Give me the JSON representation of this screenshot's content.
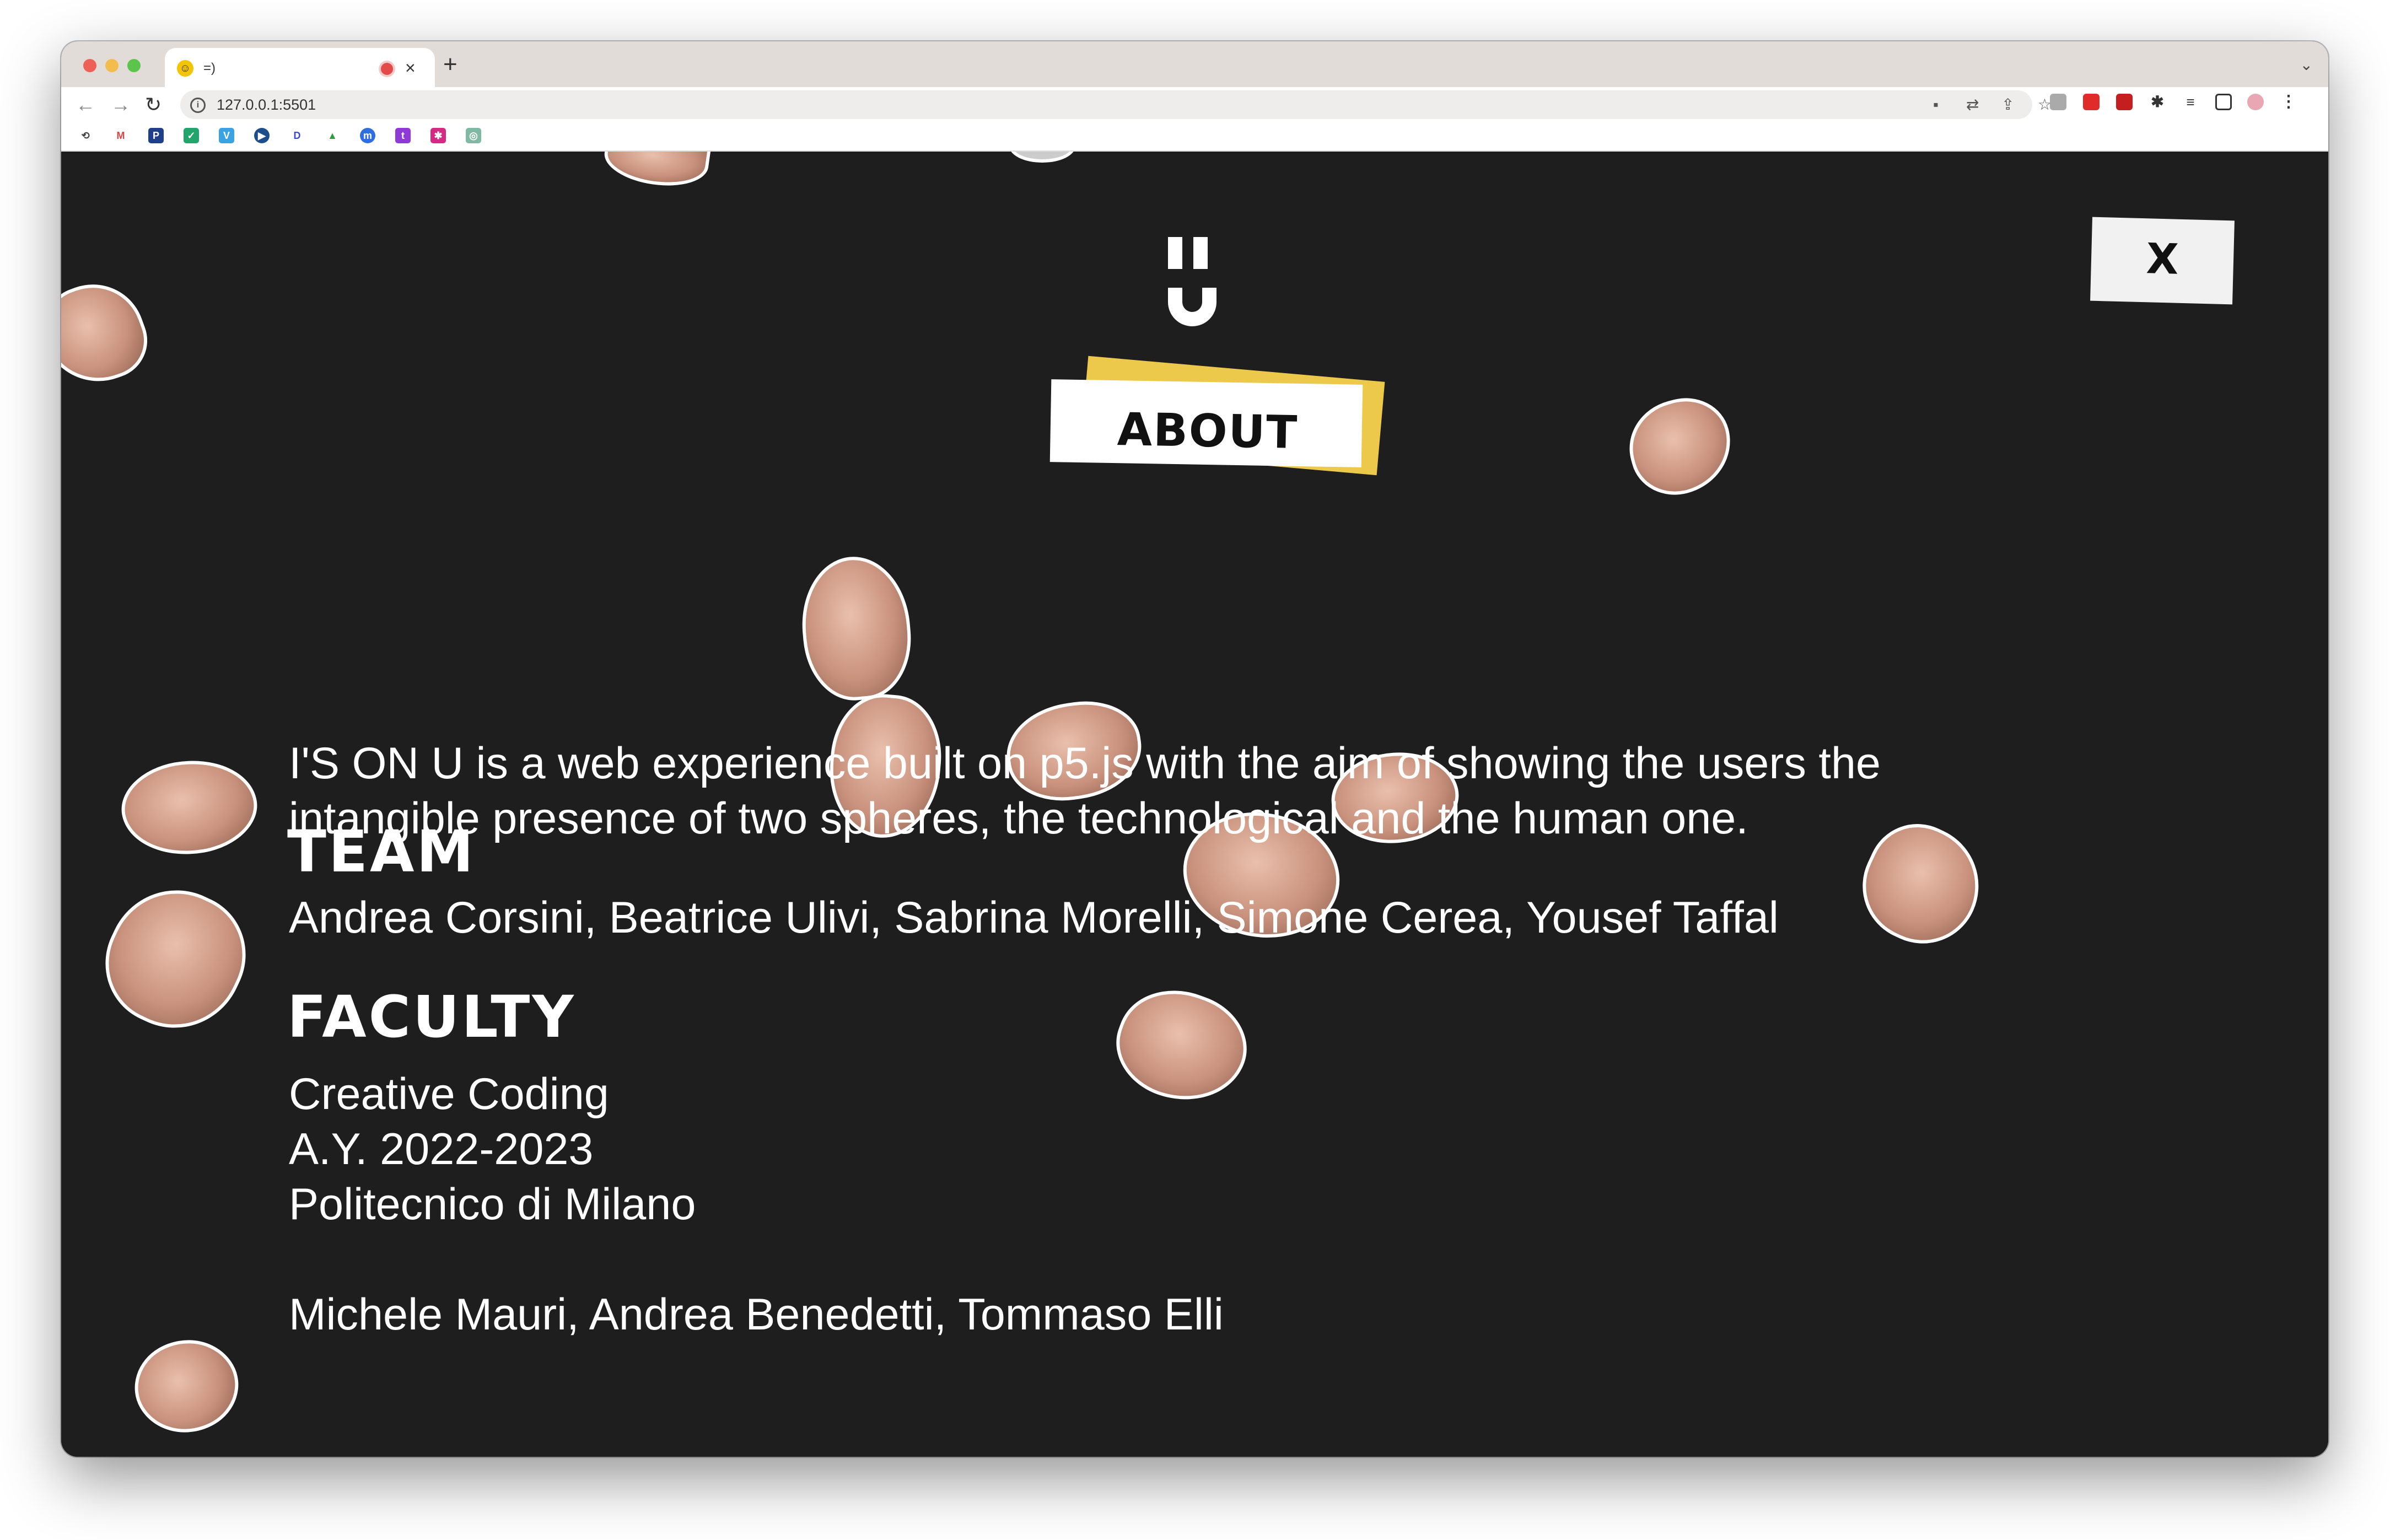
{
  "browser": {
    "tab_title": "=)",
    "url": "127.0.0.1:5501"
  },
  "page": {
    "about_label": "ABOUT",
    "close_label": "X",
    "intro_line1": "I'S ON U is a web experience built on p5.js with the aim of showing the users the",
    "intro_line2": "intangible presence of two spheres, the technological and the human one.",
    "team_heading": "TEAM",
    "team_members": "Andrea Corsini, Beatrice Ulivi, Sabrina Morelli, Simone Cerea, Yousef Taffal",
    "faculty_heading": "FACULTY",
    "faculty_line1": "Creative Coding",
    "faculty_line2": "A.Y. 2022-2023",
    "faculty_line3": "Politecnico di Milano",
    "faculty_names": "Michele Mauri, Andrea Benedetti, Tommaso Elli"
  },
  "colors": {
    "background": "#1e1e1e",
    "accent_yellow": "#edc94b",
    "text": "#ffffff"
  },
  "icons": [
    "back-icon",
    "forward-icon",
    "reload-icon",
    "info-icon",
    "camera-icon",
    "translate-icon",
    "share-icon",
    "star-icon",
    "extensions-icon",
    "reading-list-icon",
    "sidebar-icon",
    "profile-icon",
    "menu-icon",
    "close-icon"
  ]
}
